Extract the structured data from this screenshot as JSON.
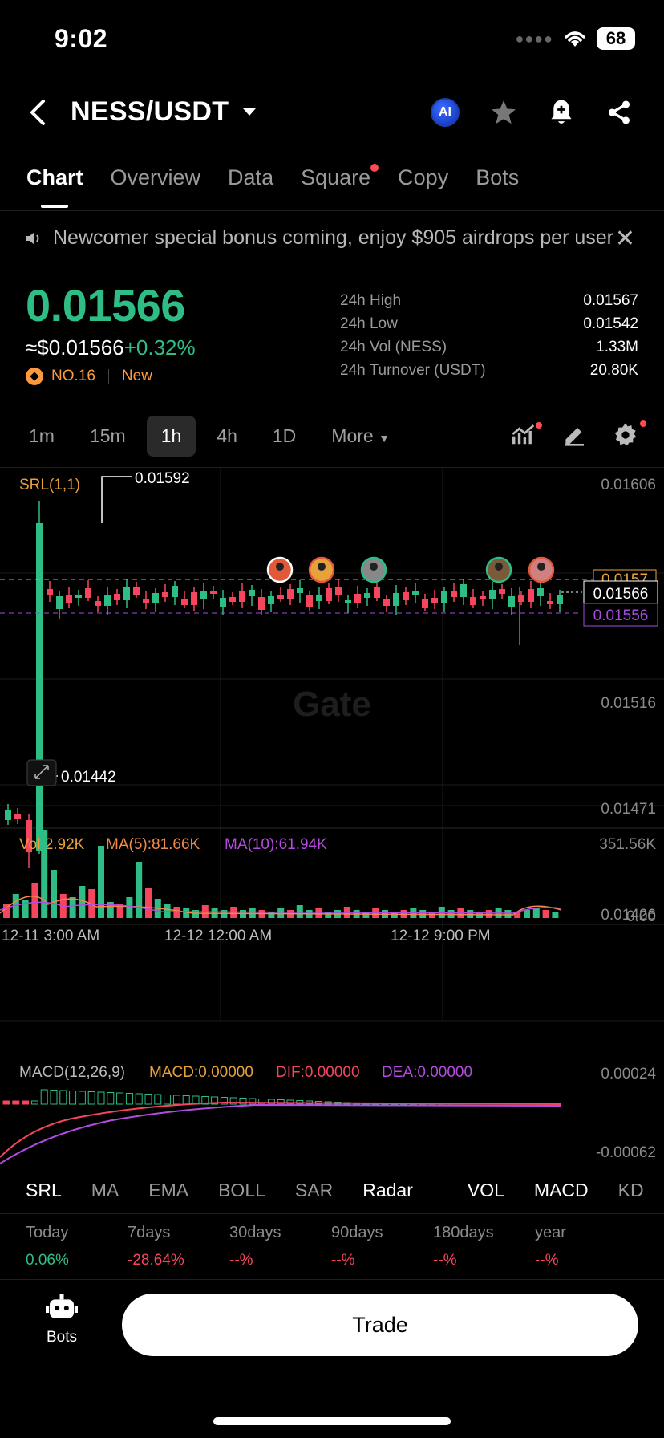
{
  "status": {
    "time": "9:02",
    "battery": "68"
  },
  "header": {
    "pair": "NESS/USDT",
    "ai_label": "AI"
  },
  "tabs": [
    {
      "label": "Chart"
    },
    {
      "label": "Overview"
    },
    {
      "label": "Data"
    },
    {
      "label": "Square"
    },
    {
      "label": "Copy"
    },
    {
      "label": "Bots"
    }
  ],
  "banner": {
    "text": "Newcomer special bonus coming, enjoy $905 airdrops per user"
  },
  "price": {
    "last": "0.01566",
    "usd": "≈$0.01566",
    "change": "+0.32%",
    "rank": "NO.16",
    "tag": "New"
  },
  "stats": [
    {
      "label": "24h High",
      "value": "0.01567"
    },
    {
      "label": "24h Low",
      "value": "0.01542"
    },
    {
      "label": "24h Vol (NESS)",
      "value": "1.33M"
    },
    {
      "label": "24h Turnover (USDT)",
      "value": "20.80K"
    }
  ],
  "timeframes": [
    {
      "label": "1m"
    },
    {
      "label": "15m"
    },
    {
      "label": "1h"
    },
    {
      "label": "4h"
    },
    {
      "label": "1D"
    },
    {
      "label": "More"
    }
  ],
  "chart": {
    "indicator_label": "SRL(1,1)",
    "watermark": "Gate",
    "y_ticks": [
      "0.01606",
      "0.01516",
      "0.01471",
      "0.01426"
    ],
    "x_ticks": [
      "12-11 3:00 AM",
      "12-12 12:00 AM",
      "12-12 9:00 PM"
    ],
    "high_marker": "0.01592",
    "low_marker": "0.01442",
    "tag_yellow": "0.0157",
    "tag_current": "0.01566",
    "tag_purple": "0.01556",
    "vol": {
      "vol": "Vol:2.92K",
      "ma5": "MA(5):81.66K",
      "ma10": "MA(10):61.94K",
      "max": "351.56K",
      "min": "0.00"
    },
    "macd": {
      "title": "MACD(12,26,9)",
      "macd": "MACD:0.00000",
      "dif": "DIF:0.00000",
      "dea": "DEA:0.00000",
      "max": "0.00024",
      "min": "-0.00062"
    },
    "colors": {
      "up": "#2ebd85",
      "down": "#f6465d"
    }
  },
  "indicators": [
    "SRL",
    "MA",
    "EMA",
    "BOLL",
    "SAR",
    "Radar",
    "VOL",
    "MACD",
    "KD"
  ],
  "performance": [
    {
      "label": "Today",
      "value": "0.06%",
      "tone": "up"
    },
    {
      "label": "7days",
      "value": "-28.64%",
      "tone": "down"
    },
    {
      "label": "30days",
      "value": "--%",
      "tone": "down"
    },
    {
      "label": "90days",
      "value": "--%",
      "tone": "down"
    },
    {
      "label": "180days",
      "value": "--%",
      "tone": "down"
    },
    {
      "label": "year",
      "value": "--%",
      "tone": "down"
    }
  ],
  "bottom": {
    "bots_label": "Bots",
    "trade_label": "Trade"
  }
}
